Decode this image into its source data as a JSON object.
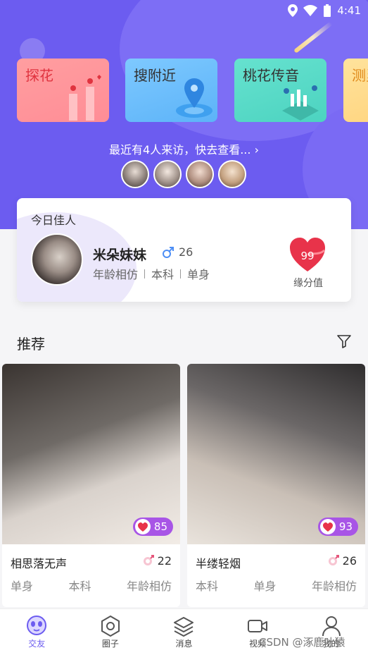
{
  "status_bar": {
    "time": "4:41"
  },
  "tiles": [
    {
      "label": "探花"
    },
    {
      "label": "搜附近"
    },
    {
      "label": "桃花传音"
    },
    {
      "label": "测灵"
    }
  ],
  "visitors": {
    "text": "最近有4人来访，快去查看...",
    "chevron": "›"
  },
  "today": {
    "title": "今日佳人",
    "name": "米朵妹妹",
    "gender_icon": "male-icon",
    "age": "26",
    "tags": [
      "年龄相仿",
      "本科",
      "单身"
    ],
    "fate_score": "99",
    "fate_label": "缘分值"
  },
  "recommend": {
    "title": "推荐",
    "cards": [
      {
        "name": "相思落无声",
        "score": "85",
        "age": "22",
        "tags": [
          "单身",
          "本科",
          "年龄相仿"
        ]
      },
      {
        "name": "半缕轻烟",
        "score": "93",
        "age": "26",
        "tags": [
          "本科",
          "单身",
          "年龄相仿"
        ]
      }
    ]
  },
  "nav": [
    {
      "label": "交友",
      "icon": "chat-face-icon"
    },
    {
      "label": "圈子",
      "icon": "hexagon-icon"
    },
    {
      "label": "消息",
      "icon": "layers-icon"
    },
    {
      "label": "视频",
      "icon": "video-icon"
    },
    {
      "label": "我的",
      "icon": "person-icon"
    }
  ],
  "watermark": "CSDN @涿鹿叶猿",
  "colors": {
    "primary": "#6c5cf0",
    "heart": "#e8334a",
    "badge": "#a855e6"
  }
}
